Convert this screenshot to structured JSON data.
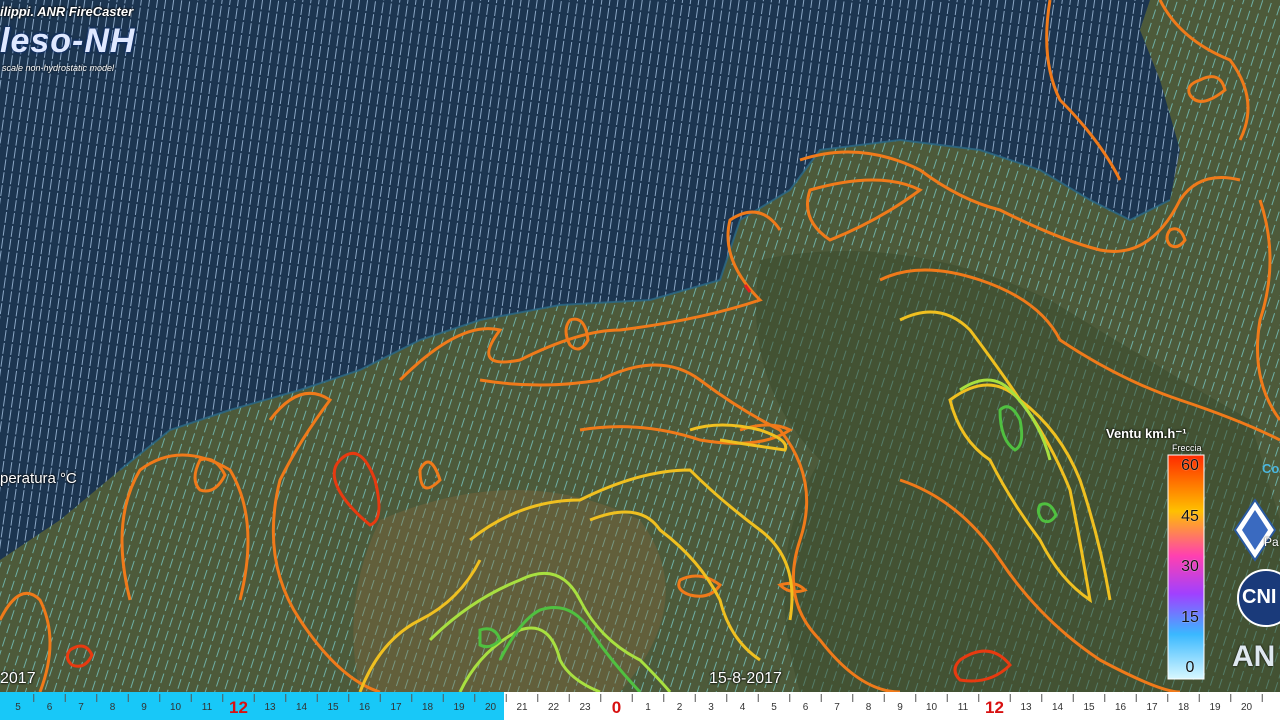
{
  "header": {
    "credit": "ilippi. ANR FireCaster",
    "logo_text": "leso-NH",
    "logo_subtitle": "scale non-hydrostatic model"
  },
  "legend": {
    "temperature_label": "peratura °C",
    "wind_title": "Ventu km.h⁻¹",
    "wind_subtitle": "Freccia",
    "colorbar_ticks": [
      "60",
      "45",
      "30",
      "15",
      "0"
    ],
    "colorbar_colors": [
      "#ff3a00",
      "#ffb400",
      "#ff40c0",
      "#b040ff",
      "#40b0ff",
      "#c0f0ff"
    ]
  },
  "dates": {
    "left": "2017",
    "middle": "15-8-2017"
  },
  "timeline": {
    "ticks": [
      "5",
      "6",
      "7",
      "8",
      "9",
      "10",
      "11",
      "12",
      "13",
      "14",
      "15",
      "16",
      "17",
      "18",
      "19",
      "20",
      "21",
      "22",
      "23",
      "0",
      "1",
      "2",
      "3",
      "4",
      "5",
      "6",
      "7",
      "8",
      "9",
      "10",
      "11",
      "12",
      "13",
      "14",
      "15",
      "16",
      "17",
      "18",
      "19",
      "20"
    ],
    "highlight": [
      "12",
      "0",
      "12"
    ],
    "elapsed_color": "#18c8f8"
  },
  "side_logos": {
    "right_partial_1": "Co",
    "right_partial_2": "Pa",
    "cnr": "CNI",
    "anr": "AN"
  }
}
